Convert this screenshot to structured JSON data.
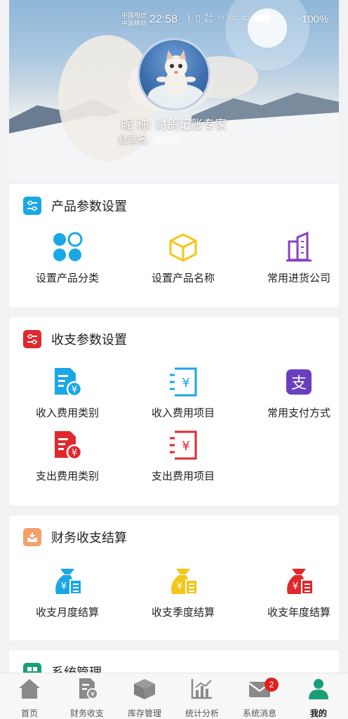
{
  "status_bar": {
    "carrier_1": "中国电信",
    "carrier_2": "中国移动",
    "time": "22:58",
    "net_speed_top": "4.1",
    "net_speed_unit": "K/s",
    "signal_1": "5G",
    "signal_2": "4G",
    "battery": "100%"
  },
  "profile": {
    "nickname_label": "昵 称:",
    "nickname": "财鸽记账专家",
    "login_label": "登录名:"
  },
  "sections": [
    {
      "title": "产品参数设置",
      "icon": "sliders-icon",
      "color": "#1aa7e6",
      "items": [
        {
          "label": "设置产品分类",
          "icon": "category-icon",
          "color": "#1aa7e6"
        },
        {
          "label": "设置产品名称",
          "icon": "box-icon",
          "color": "#f5c518"
        },
        {
          "label": "常用进货公司",
          "icon": "building-icon",
          "color": "#8a3fbf"
        }
      ]
    },
    {
      "title": "收支参数设置",
      "icon": "sliders-icon",
      "color": "#e0282e",
      "items": [
        {
          "label": "收入费用类别",
          "icon": "doc-yen-icon",
          "color": "#1aa7e6"
        },
        {
          "label": "收入费用项目",
          "icon": "yen-list-icon",
          "color": "#1aa7e6"
        },
        {
          "label": "常用支付方式",
          "icon": "alipay-icon",
          "color": "#6a3fbf"
        },
        {
          "label": "支出费用类别",
          "icon": "doc-yen-icon",
          "color": "#e0282e"
        },
        {
          "label": "支出费用项目",
          "icon": "yen-list-icon",
          "color": "#e0282e"
        }
      ]
    },
    {
      "title": "财务收支结算",
      "icon": "tray-icon",
      "color": "#f5a06a",
      "items": [
        {
          "label": "收支月度结算",
          "icon": "money-bag-icon",
          "color": "#1aa7e6"
        },
        {
          "label": "收支季度结算",
          "icon": "money-bag-icon",
          "color": "#f5c518"
        },
        {
          "label": "收支年度结算",
          "icon": "money-bag-icon",
          "color": "#e0282e"
        }
      ]
    },
    {
      "title": "系统管理",
      "icon": "grid-icon",
      "color": "#1a9e7a"
    }
  ],
  "tabs": [
    {
      "label": "首页",
      "icon": "home-icon"
    },
    {
      "label": "财务收支",
      "icon": "finance-doc-icon"
    },
    {
      "label": "库存管理",
      "icon": "inventory-box-icon"
    },
    {
      "label": "统计分析",
      "icon": "bar-chart-icon"
    },
    {
      "label": "系统消息",
      "icon": "mail-icon",
      "badge": "2"
    },
    {
      "label": "我的",
      "icon": "user-icon",
      "active": true
    }
  ]
}
